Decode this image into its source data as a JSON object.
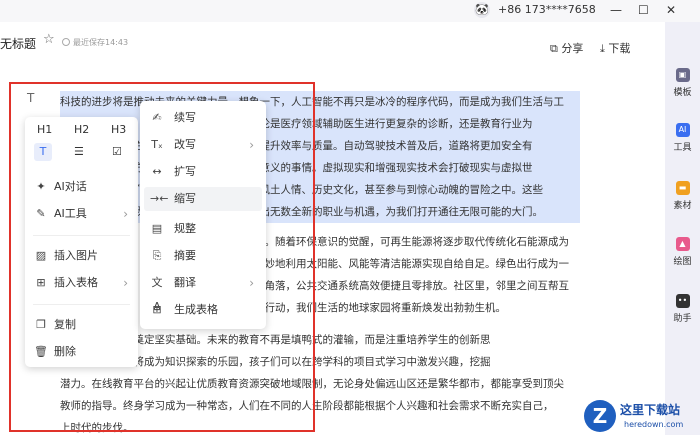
{
  "window": {
    "user_phone": "+86 173****7658",
    "minimize": "—",
    "maximize": "☐",
    "close": "✕"
  },
  "header": {
    "title": "无标题",
    "save_status": "最近保存14:43",
    "share_label": "分享",
    "download_label": "下载"
  },
  "sidebar": {
    "items": [
      {
        "label": "模板",
        "icon": "template-icon"
      },
      {
        "label": "工具",
        "icon": "ai-tool-icon",
        "glyph": "AI"
      },
      {
        "label": "素材",
        "icon": "folder-icon"
      },
      {
        "label": "绘图",
        "icon": "paint-icon"
      },
      {
        "label": "助手",
        "icon": "assistant-icon"
      }
    ]
  },
  "document": {
    "para1_lines": [
      "科技的进步将是推动未来的关键力量。想象一下，人工智能不再只是冰冷的程序代码，而是成为我们生活与工",
      "作中默契的伙伴，它能理解我们的需求，无论是医疗领域辅助医生进行更复杂的诊断，还是教育行业为",
      "学生量身定制个性化学习方案，都将极大地提升效率与质量。自动驾驶技术普及后，道路将更加安全有",
      "序，人们的出行方式也将以更加追求更多有意义的事情。虚拟现实和增强现实技术会打破现实与虚拟世",
      "界的界限，让人们足不出户就能领略各地的风土人情、历史文化，甚至参与到惊心动魄的冒险之中。这些",
      "技术不仅将改变我们的生活方式，还会催生出无数全新的职业与机遇，为我们打开通往无限可能的大门。"
    ],
    "para2_lines": [
      "心。随着环保意识的觉醒，可再生能源将逐步取代传统化石能源成为",
      "巧妙地利用太阳能、风能等清洁能源实现自给自足。绿色出行成为一",
      "个角落，公共交通系统高效便捷且零排放。社区里，邻里之间互帮互",
      "觉行动，我们生活的地球家园将重新焕发出勃勃生机。"
    ],
    "para3_lines": [
      "将为我们的未来奠定坚实基础。未来的教育不再是填鸭式的灌输，而是注重培养学生的创新思",
      "全球视野。学校将成为知识探索的乐园，孩子们可以在跨学科的项目式学习中激发兴趣，挖掘",
      "潜力。在线教育平台的兴起让优质教育资源突破地域限制，无论身处偏远山区还是繁华都市，都能享受到顶尖",
      "教师的指导。终身学习成为一种常态，人们在不同的人生阶段都能根据个人兴趣和社会需求不断充实自己，",
      "上时代的步伐。"
    ]
  },
  "main_menu": {
    "headings": [
      "H1",
      "H2",
      "H3"
    ],
    "format_row": [
      "text-format-icon",
      "list-icon",
      "checkbox-icon"
    ],
    "items": [
      {
        "label": "AI对话",
        "icon": "sparkle-icon",
        "has_submenu": false
      },
      {
        "label": "AI工具",
        "icon": "pen-icon",
        "has_submenu": true
      },
      {
        "label": "插入图片",
        "icon": "image-icon",
        "has_submenu": false
      },
      {
        "label": "插入表格",
        "icon": "table-icon",
        "has_submenu": true
      },
      {
        "label": "复制",
        "icon": "copy-icon",
        "has_submenu": false
      },
      {
        "label": "删除",
        "icon": "trash-icon",
        "has_submenu": false
      }
    ]
  },
  "sub_menu": {
    "items": [
      {
        "label": "续写",
        "icon": "continue-write-icon",
        "has_submenu": false
      },
      {
        "label": "改写",
        "icon": "rewrite-icon",
        "has_submenu": true
      },
      {
        "label": "扩写",
        "icon": "expand-icon",
        "has_submenu": false
      },
      {
        "label": "缩写",
        "icon": "shrink-icon",
        "has_submenu": false
      },
      {
        "label": "规整",
        "icon": "tidy-icon",
        "has_submenu": false
      },
      {
        "label": "摘要",
        "icon": "summary-icon",
        "has_submenu": false
      },
      {
        "label": "翻译",
        "icon": "translate-icon",
        "has_submenu": true
      },
      {
        "label": "生成表格",
        "icon": "generate-table-icon",
        "has_submenu": false
      }
    ],
    "active_index": 3
  },
  "watermark": {
    "name": "这里下载站",
    "url": "heredown.com",
    "glyph": "Z"
  },
  "colors": {
    "accent": "#3a6ef0",
    "highlight": "#d9e4fb",
    "annotation_red": "#e0322a",
    "sidebar_bg": "#efeff7"
  }
}
